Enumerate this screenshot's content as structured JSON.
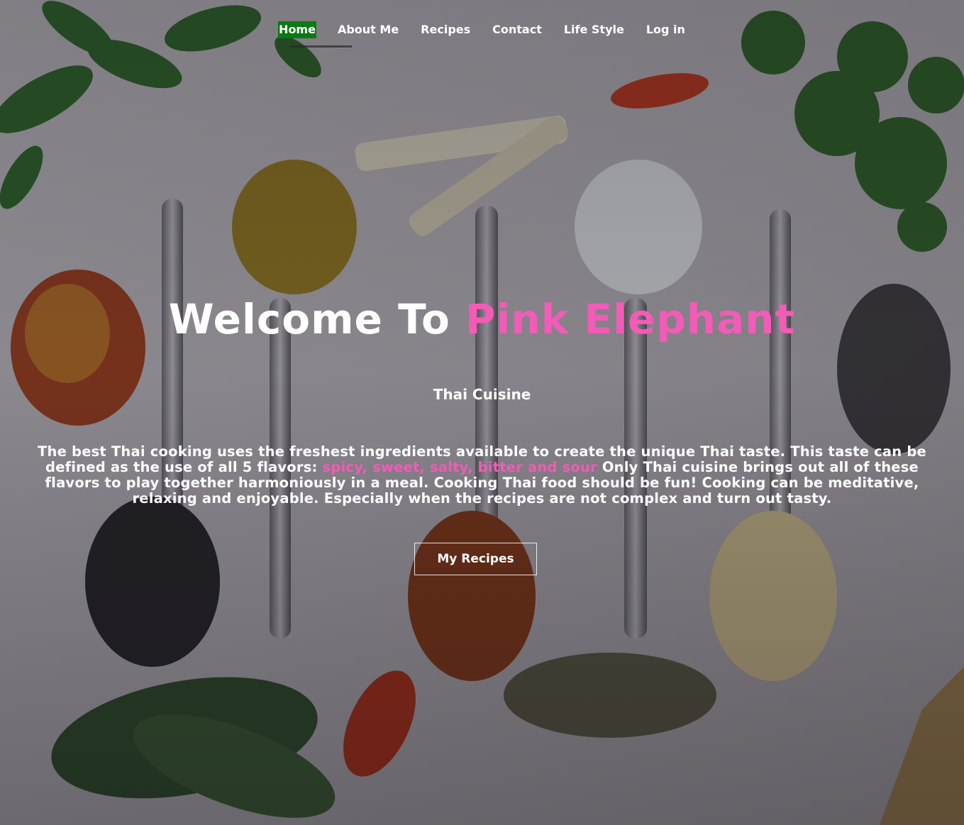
{
  "nav": {
    "items": [
      {
        "label": "Home",
        "active": true
      },
      {
        "label": "About Me"
      },
      {
        "label": "Recipes"
      },
      {
        "label": "Contact"
      },
      {
        "label": "Life Style"
      },
      {
        "label": "Log in"
      }
    ]
  },
  "hero": {
    "title_prefix": "Welcome To ",
    "title_brand": "Pink Elephant",
    "subtitle": "Thai Cuisine",
    "intro_before": "The best Thai cooking uses the freshest ingredients available to create the unique Thai taste. This taste can be defined as the use of all 5 flavors: ",
    "intro_flavors": "spicy, sweet, salty, bitter and sour",
    "intro_after": " Only Thai cuisine brings out all of these flavors to play together harmoniously in a meal. Cooking Thai food should be fun! Cooking can be meditative, relaxing and enjoyable. Especially when the recipes are not complex and turn out tasty.",
    "cta_label": "My Recipes"
  },
  "colors": {
    "brand_pink": "#f25bb7",
    "active_nav_bg": "#0a7a12",
    "text": "#ffffff"
  }
}
